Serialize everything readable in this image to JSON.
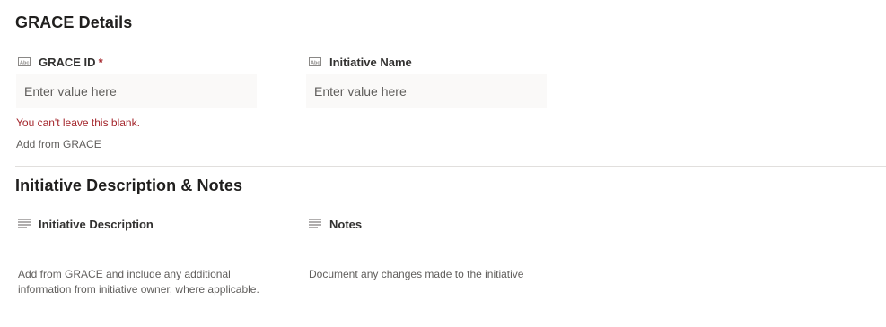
{
  "sections": {
    "grace_details": {
      "title": "GRACE Details",
      "grace_id": {
        "label": "GRACE ID",
        "required_mark": "*",
        "placeholder": "Enter value here",
        "value": "",
        "error": "You can't leave this blank.",
        "helper": "Add from GRACE",
        "icon": "text-field-icon"
      },
      "initiative_name": {
        "label": "Initiative Name",
        "placeholder": "Enter value here",
        "value": "",
        "icon": "text-field-icon"
      }
    },
    "description_notes": {
      "title": "Initiative Description & Notes",
      "initiative_description": {
        "label": "Initiative Description",
        "helper": "Add from GRACE and include any additional information from initiative owner, where applicable.",
        "icon": "multiline-text-icon"
      },
      "notes": {
        "label": "Notes",
        "helper": "Document any changes made to the initiative",
        "icon": "multiline-text-icon"
      }
    }
  },
  "colors": {
    "error": "#a4262c",
    "input_bg": "#faf9f8",
    "divider": "#e1dfdd",
    "text": "#323130",
    "muted": "#605e5c"
  }
}
